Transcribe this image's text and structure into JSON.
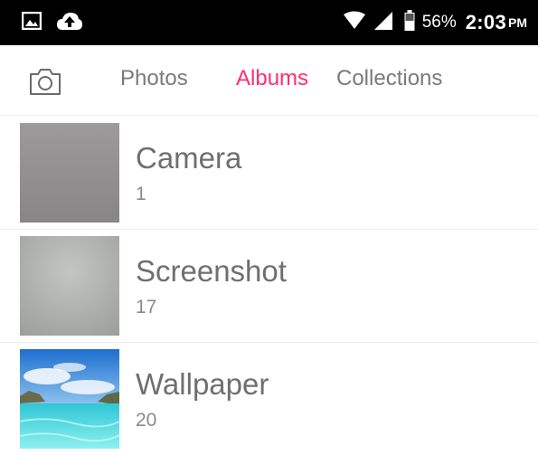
{
  "status_bar": {
    "battery_percent": "56%",
    "time": "2:03",
    "ampm": "PM",
    "icons": [
      "image-notification-icon",
      "cloud-upload-icon",
      "wifi-icon",
      "cellular-signal-icon",
      "battery-icon"
    ]
  },
  "tabs": [
    {
      "label": "Photos",
      "active": false
    },
    {
      "label": "Albums",
      "active": true
    },
    {
      "label": "Collections",
      "active": false
    }
  ],
  "colors": {
    "accent": "#ff2e6e",
    "tab_inactive": "#7a7a7a",
    "text_primary": "#6f6f6f",
    "status_bar_bg": "#000000"
  },
  "albums": [
    {
      "name": "Camera",
      "count": "1"
    },
    {
      "name": "Screenshot",
      "count": "17"
    },
    {
      "name": "Wallpaper",
      "count": "20"
    }
  ]
}
